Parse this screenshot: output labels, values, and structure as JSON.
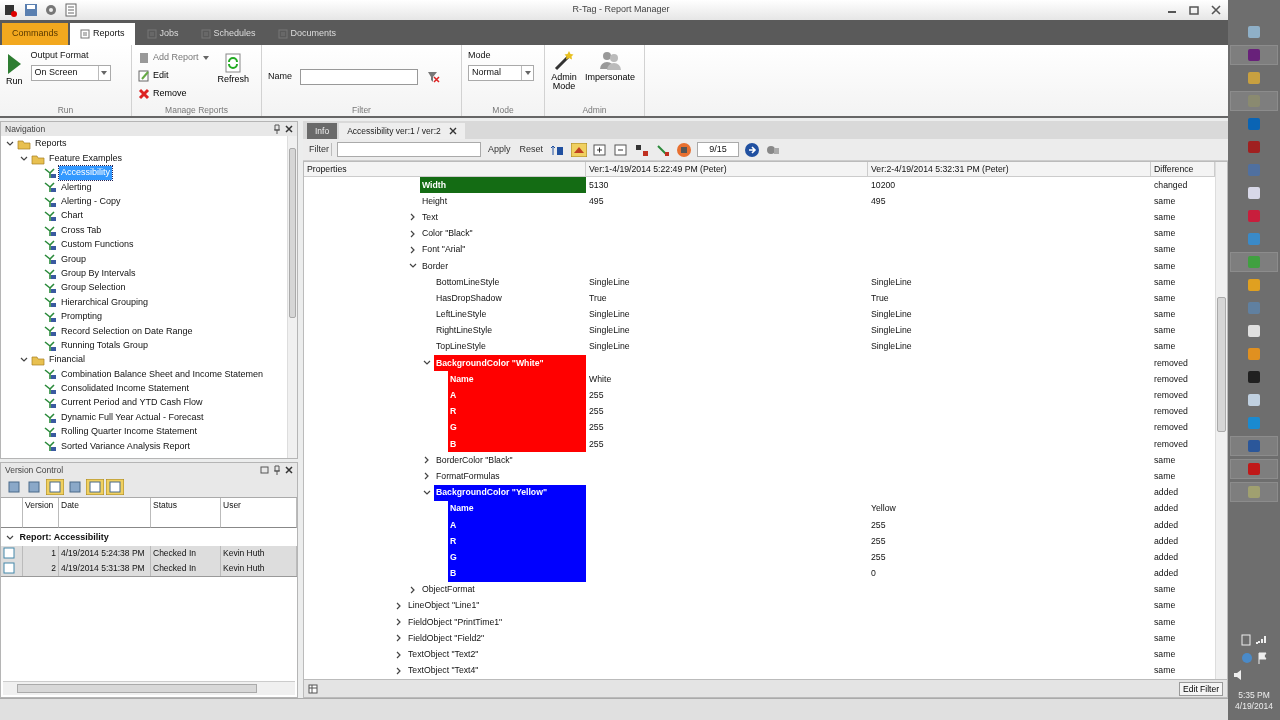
{
  "window": {
    "title": "R-Tag - Report Manager"
  },
  "ribbon_tabs": [
    {
      "label": "Commands",
      "kind": "context",
      "selected": false
    },
    {
      "label": "Reports",
      "kind": "normal",
      "selected": true
    },
    {
      "label": "Jobs",
      "kind": "normal",
      "selected": false
    },
    {
      "label": "Schedules",
      "kind": "normal",
      "selected": false
    },
    {
      "label": "Documents",
      "kind": "normal",
      "selected": false
    }
  ],
  "ribbon": {
    "run": {
      "button": "Run",
      "output_format_label": "Output Format",
      "output_format": "On Screen",
      "group": "Run"
    },
    "manage": {
      "add": "Add Report",
      "edit": "Edit",
      "remove": "Remove",
      "refresh": "Refresh",
      "group": "Manage Reports"
    },
    "filter": {
      "name_label": "Name",
      "group": "Filter"
    },
    "mode": {
      "label": "Mode",
      "value": "Normal",
      "group": "Mode"
    },
    "admin": {
      "admin_mode": "Admin Mode",
      "impersonate": "Impersonate",
      "group": "Admin"
    }
  },
  "navigation": {
    "title": "Navigation",
    "tree": [
      {
        "label": "Reports",
        "expanded": true,
        "children": [
          {
            "label": "Feature Examples",
            "expanded": true,
            "children": [
              {
                "label": "Accessibility",
                "selected": true
              },
              {
                "label": "Alerting",
                "selected": false
              },
              {
                "label": "Alerting  - Copy",
                "selected": false
              },
              {
                "label": "Chart",
                "selected": false
              },
              {
                "label": "Cross Tab",
                "selected": false
              },
              {
                "label": "Custom Functions",
                "selected": false
              },
              {
                "label": "Group",
                "selected": false
              },
              {
                "label": "Group By Intervals",
                "selected": false
              },
              {
                "label": "Group Selection",
                "selected": false
              },
              {
                "label": "Hierarchical Grouping",
                "selected": false
              },
              {
                "label": "Prompting",
                "selected": false
              },
              {
                "label": "Record Selection on Date Range",
                "selected": false
              },
              {
                "label": "Running Totals Group",
                "selected": false
              }
            ]
          },
          {
            "label": "Financial",
            "expanded": true,
            "children": [
              {
                "label": "Combination Balance Sheet and Income Statemen",
                "selected": false
              },
              {
                "label": "Consolidated Income Statement",
                "selected": false
              },
              {
                "label": "Current Period and YTD Cash Flow",
                "selected": false
              },
              {
                "label": "Dynamic Full Year Actual - Forecast",
                "selected": false
              },
              {
                "label": "Rolling Quarter Income Statement",
                "selected": false
              },
              {
                "label": "Sorted Variance Analysis Report",
                "selected": false
              }
            ]
          }
        ]
      }
    ]
  },
  "version_control": {
    "title": "Version Control",
    "columns": [
      "Version",
      "Date",
      "Status",
      "User"
    ],
    "group": "Report: Accessibility",
    "rows": [
      {
        "version": "1",
        "date": "4/19/2014 5:24:38 PM",
        "status": "Checked In",
        "user": "Kevin Huth"
      },
      {
        "version": "2",
        "date": "4/19/2014 5:31:38 PM",
        "status": "Checked In",
        "user": "Kevin Huth"
      }
    ]
  },
  "doc_tabs": [
    {
      "label": "Info",
      "closable": false,
      "selected": false
    },
    {
      "label": "Accessibility ver:1 / ver:2",
      "closable": true,
      "selected": true
    }
  ],
  "diff_toolbar": {
    "filter_label": "Filter",
    "apply": "Apply",
    "reset": "Reset",
    "counter": "9/15"
  },
  "diff": {
    "columns": [
      "Properties",
      "Ver:1-4/19/2014 5:22:49 PM (Peter)",
      "Ver:2-4/19/2014 5:32:31 PM (Peter)",
      "Difference"
    ],
    "rows": [
      {
        "children": [
          {
            "label": "Width",
            "v1": "5130",
            "v2": "10200",
            "difference": "changed",
            "color": "#146c14"
          },
          {
            "label": "Height",
            "v1": "495",
            "v2": "495",
            "difference": "same"
          },
          {
            "label": "Text",
            "expanded": false,
            "difference": "same"
          },
          {
            "label": "Color \"Black\"",
            "expanded": false,
            "difference": "same"
          },
          {
            "label": "Font \"Arial\"",
            "expanded": false,
            "difference": "same"
          },
          {
            "label": "Border",
            "expanded": true,
            "difference": "same",
            "children": [
              {
                "label": "BottomLineStyle",
                "v1": "SingleLine",
                "v2": "SingleLine",
                "difference": "same"
              },
              {
                "label": "HasDropShadow",
                "v1": "True",
                "v2": "True",
                "difference": "same"
              },
              {
                "label": "LeftLineStyle",
                "v1": "SingleLine",
                "v2": "SingleLine",
                "difference": "same"
              },
              {
                "label": "RightLineStyle",
                "v1": "SingleLine",
                "v2": "SingleLine",
                "difference": "same"
              },
              {
                "label": "TopLineStyle",
                "v1": "SingleLine",
                "v2": "SingleLine",
                "difference": "same"
              },
              {
                "label": "BackgroundColor \"White\"",
                "expanded": true,
                "difference": "removed",
                "color": "#ff0000",
                "children": [
                  {
                    "label": "Name",
                    "v1": "White",
                    "difference": "removed",
                    "color": "#ff0000"
                  },
                  {
                    "label": "A",
                    "v1": "255",
                    "difference": "removed",
                    "color": "#ff0000"
                  },
                  {
                    "label": "R",
                    "v1": "255",
                    "difference": "removed",
                    "color": "#ff0000"
                  },
                  {
                    "label": "G",
                    "v1": "255",
                    "difference": "removed",
                    "color": "#ff0000"
                  },
                  {
                    "label": "B",
                    "v1": "255",
                    "difference": "removed",
                    "color": "#ff0000"
                  }
                ]
              },
              {
                "label": "BorderColor \"Black\"",
                "expanded": false,
                "difference": "same"
              },
              {
                "label": "FormatFormulas",
                "expanded": false,
                "difference": "same"
              },
              {
                "label": "BackgroundColor \"Yellow\"",
                "expanded": true,
                "difference": "added",
                "color": "#0000ff",
                "children": [
                  {
                    "label": "Name",
                    "v2": "Yellow",
                    "difference": "added",
                    "color": "#0000ff"
                  },
                  {
                    "label": "A",
                    "v2": "255",
                    "difference": "added",
                    "color": "#0000ff"
                  },
                  {
                    "label": "R",
                    "v2": "255",
                    "difference": "added",
                    "color": "#0000ff"
                  },
                  {
                    "label": "G",
                    "v2": "255",
                    "difference": "added",
                    "color": "#0000ff"
                  },
                  {
                    "label": "B",
                    "v2": "0",
                    "difference": "added",
                    "color": "#0000ff"
                  }
                ]
              }
            ]
          },
          {
            "label": "ObjectFormat",
            "expanded": false,
            "difference": "same"
          }
        ]
      },
      {
        "label": "LineObject \"Line1\"",
        "expanded": false,
        "difference": "same"
      },
      {
        "label": "FieldObject \"PrintTime1\"",
        "expanded": false,
        "difference": "same"
      },
      {
        "label": "FieldObject \"Field2\"",
        "expanded": false,
        "difference": "same"
      },
      {
        "label": "TextObject \"Text2\"",
        "expanded": false,
        "difference": "same"
      },
      {
        "label": "TextObject \"Text4\"",
        "expanded": false,
        "difference": "same"
      }
    ]
  },
  "diff_footer": {
    "edit_filter": "Edit Filter"
  },
  "taskbar": {
    "apps": [
      {
        "color": "#8fb0c8",
        "selected": false
      },
      {
        "color": "#68217a",
        "selected": true
      },
      {
        "color": "#c8a040",
        "selected": false
      },
      {
        "color": "#8a8a70",
        "selected": true
      },
      {
        "color": "#0a64b4",
        "selected": false
      },
      {
        "color": "#a02020",
        "selected": false
      },
      {
        "color": "#5070a0",
        "selected": false
      },
      {
        "color": "#d8d8e8",
        "selected": false
      },
      {
        "color": "#c81e3c",
        "selected": false
      },
      {
        "color": "#3a8ac8",
        "selected": false
      },
      {
        "color": "#40a040",
        "selected": true
      },
      {
        "color": "#e0a020",
        "selected": false
      },
      {
        "color": "#6080a0",
        "selected": false
      },
      {
        "color": "#e0e0e0",
        "selected": false
      },
      {
        "color": "#e09020",
        "selected": false
      },
      {
        "color": "#202020",
        "selected": false
      },
      {
        "color": "#c0d0e0",
        "selected": false
      },
      {
        "color": "#1a8ad0",
        "selected": false
      },
      {
        "color": "#2b579a",
        "selected": true
      },
      {
        "color": "#c01818",
        "selected": true
      },
      {
        "color": "#a0a070",
        "selected": true
      }
    ],
    "time": "5:35 PM",
    "date": "4/19/2014"
  }
}
